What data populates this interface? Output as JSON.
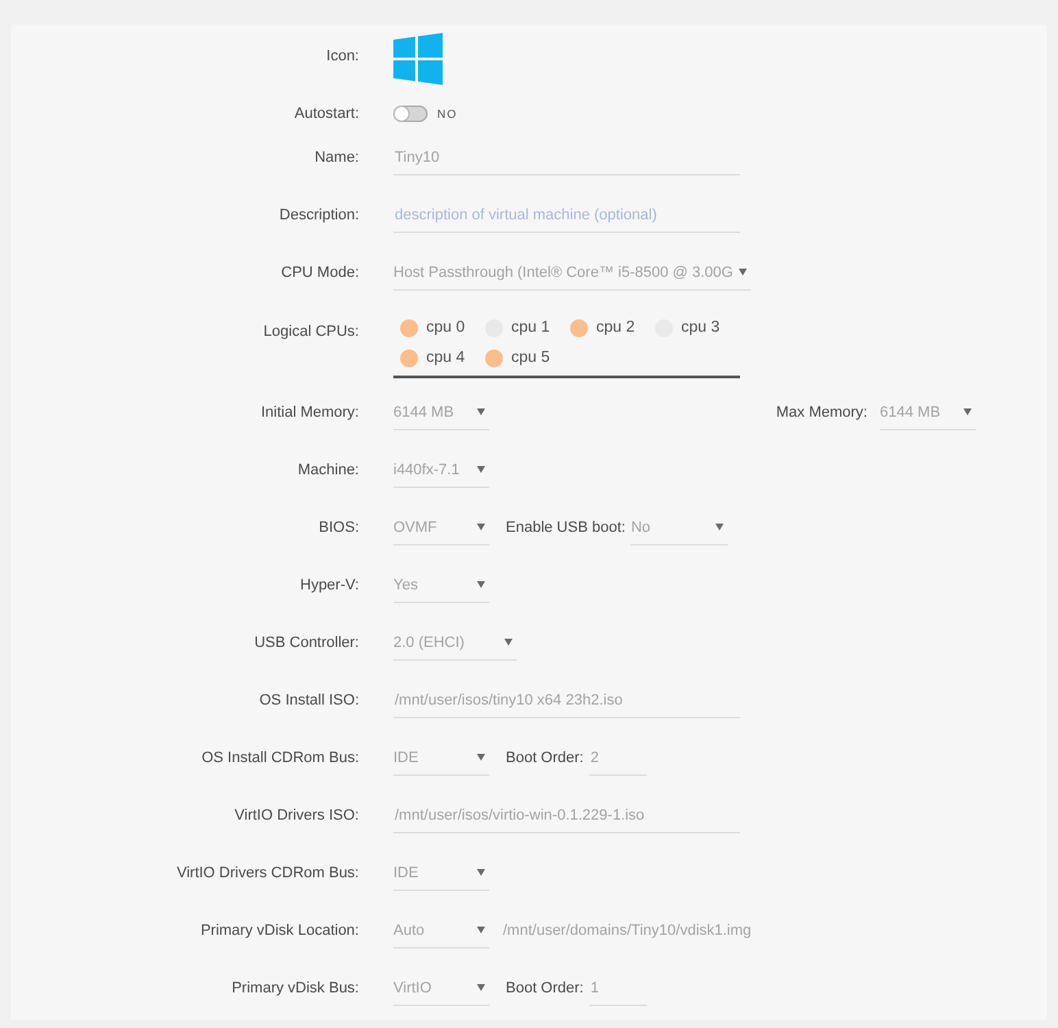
{
  "rows": [
    {
      "kind": "icon",
      "label": "Icon:"
    },
    {
      "kind": "toggle",
      "label": "Autostart:",
      "on": false,
      "state": "NO"
    },
    {
      "kind": "fields",
      "label": "Name:",
      "controls": [
        {
          "kind": "input",
          "value": "Tiny10"
        }
      ]
    },
    {
      "kind": "fields",
      "label": "Description:",
      "controls": [
        {
          "kind": "input",
          "placeholder": "description of virtual machine (optional)"
        }
      ]
    },
    {
      "kind": "fields",
      "label": "CPU Mode:",
      "controls": [
        {
          "kind": "select",
          "value": "Host Passthrough (Intel® Core™ i5-8500 @ 3.00G"
        }
      ]
    },
    {
      "kind": "cpus",
      "label": "Logical CPUs:",
      "cpus": [
        {
          "label": "cpu 0",
          "checked": true
        },
        {
          "label": "cpu 1",
          "checked": false
        },
        {
          "label": "cpu 2",
          "checked": true
        },
        {
          "label": "cpu 3",
          "checked": false
        },
        {
          "label": "cpu 4",
          "checked": true
        },
        {
          "label": "cpu 5",
          "checked": true
        }
      ]
    },
    {
      "kind": "fields",
      "label": "Initial Memory:",
      "controls": [
        {
          "kind": "select",
          "value": "6144 MB"
        }
      ],
      "right_controls": [
        {
          "kind": "label",
          "text": "Max Memory:"
        },
        {
          "kind": "select",
          "value": "6144 MB"
        }
      ]
    },
    {
      "kind": "fields",
      "label": "Machine:",
      "controls": [
        {
          "kind": "select",
          "value": "i440fx-7.1"
        }
      ]
    },
    {
      "kind": "fields",
      "label": "BIOS:",
      "controls": [
        {
          "kind": "select",
          "value": "OVMF"
        },
        {
          "kind": "label",
          "text": "Enable USB boot:"
        },
        {
          "kind": "select",
          "value": "No"
        }
      ]
    },
    {
      "kind": "fields",
      "label": "Hyper-V:",
      "controls": [
        {
          "kind": "select",
          "value": "Yes"
        }
      ]
    },
    {
      "kind": "fields",
      "label": "USB Controller:",
      "controls": [
        {
          "kind": "select",
          "value": "2.0 (EHCI)"
        }
      ]
    },
    {
      "kind": "fields",
      "label": "OS Install ISO:",
      "controls": [
        {
          "kind": "input",
          "value": "/mnt/user/isos/tiny10 x64 23h2.iso"
        }
      ]
    },
    {
      "kind": "fields",
      "label": "OS Install CDRom Bus:",
      "controls": [
        {
          "kind": "select",
          "value": "IDE"
        },
        {
          "kind": "label",
          "text": "Boot Order:"
        },
        {
          "kind": "input",
          "value": "2"
        }
      ]
    },
    {
      "kind": "fields",
      "label": "VirtIO Drivers ISO:",
      "controls": [
        {
          "kind": "input",
          "value": "/mnt/user/isos/virtio-win-0.1.229-1.iso"
        }
      ]
    },
    {
      "kind": "fields",
      "label": "VirtIO Drivers CDRom Bus:",
      "controls": [
        {
          "kind": "select",
          "value": "IDE"
        }
      ]
    },
    {
      "kind": "fields",
      "label": "Primary vDisk Location:",
      "controls": [
        {
          "kind": "select",
          "value": "Auto"
        },
        {
          "kind": "path",
          "text": "/mnt/user/domains/Tiny10/vdisk1.img"
        }
      ]
    },
    {
      "kind": "fields",
      "label": "Primary vDisk Bus:",
      "controls": [
        {
          "kind": "select",
          "value": "VirtIO"
        },
        {
          "kind": "label",
          "text": "Boot Order:"
        },
        {
          "kind": "input",
          "value": "1"
        }
      ]
    }
  ]
}
